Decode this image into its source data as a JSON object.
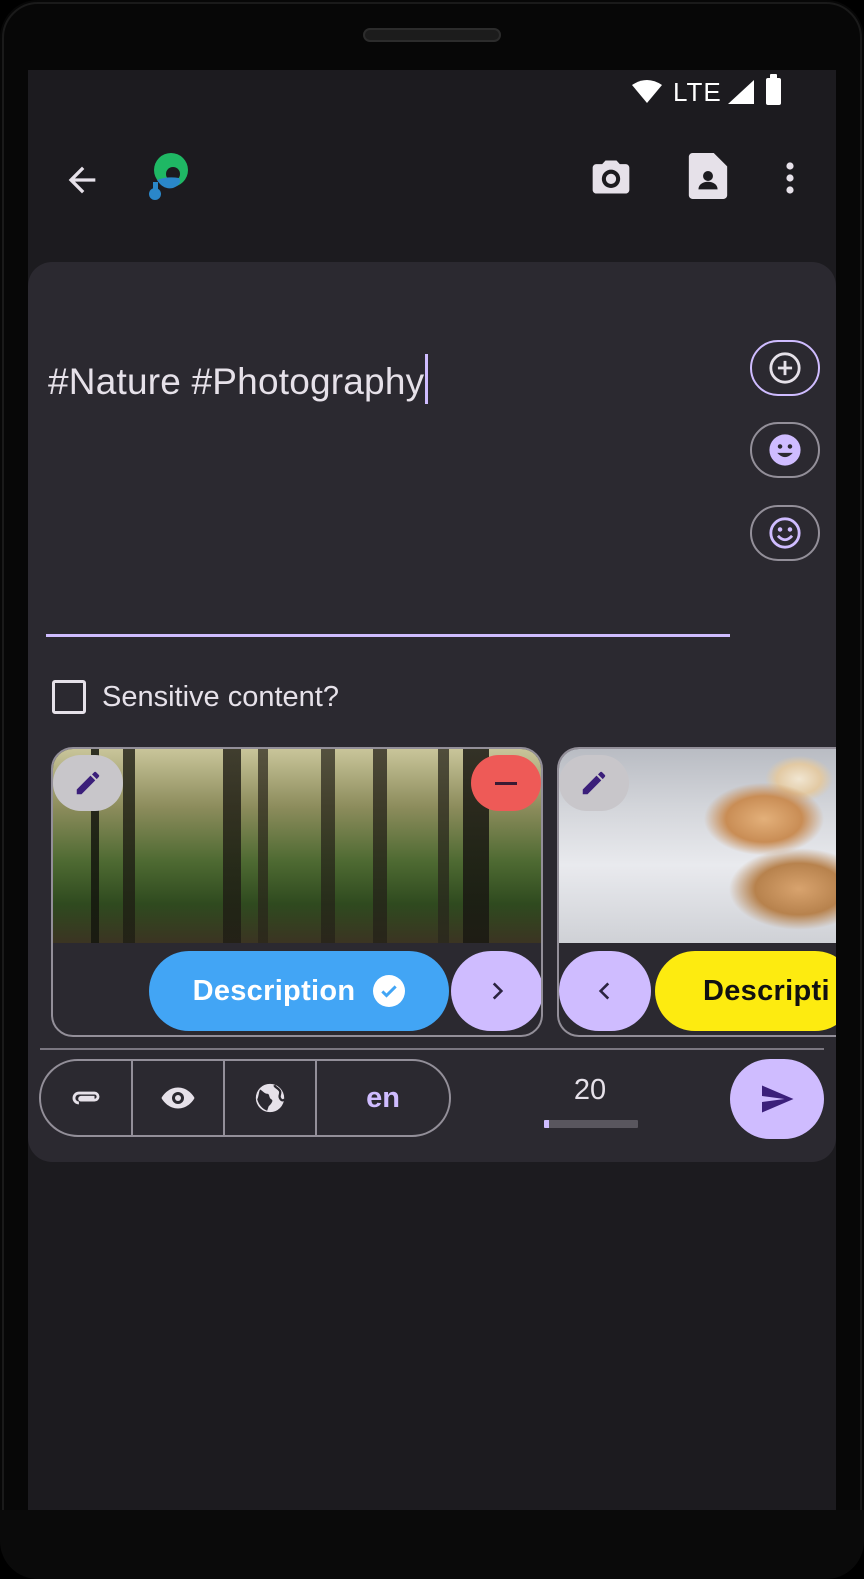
{
  "status_bar": {
    "network": "LTE",
    "icons": [
      "wifi-icon",
      "signal-icon",
      "battery-icon"
    ]
  },
  "app_bar": {
    "icons": [
      "back-arrow-icon",
      "app-logo-icon",
      "camera-icon",
      "document-icon",
      "overflow-menu-icon"
    ]
  },
  "composer": {
    "text": "#Nature #Photography",
    "side_buttons": [
      "add-circle-icon",
      "emoji-icon",
      "emoji-outline-icon"
    ],
    "sensitive_label": "Sensitive content?",
    "sensitive_checked": false
  },
  "media": [
    {
      "description_label": "Description",
      "description_done": true,
      "nav": "next"
    },
    {
      "description_label": "Descripti",
      "description_done": false,
      "nav": "previous"
    }
  ],
  "bottom_bar": {
    "language": "en",
    "char_count": "20",
    "char_progress": 0.05
  },
  "colors": {
    "accent": "#cfbcff",
    "description_done": "#42a5f5",
    "description_todo": "#fdeb10",
    "remove": "#ee5a57",
    "surface": "#2b2930",
    "background": "#1c1b1f"
  }
}
